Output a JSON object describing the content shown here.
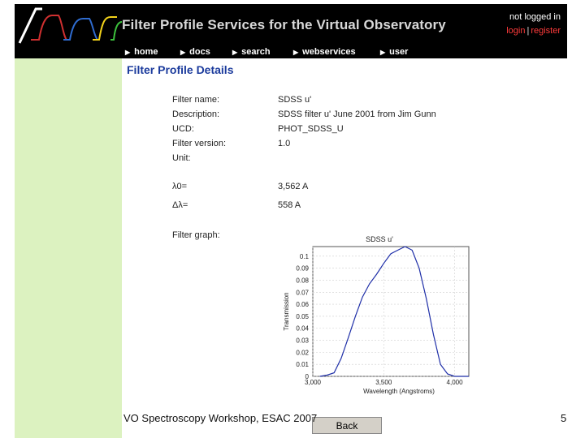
{
  "banner": {
    "title": "Filter Profile Services for the Virtual Observatory",
    "login_status": "not logged in",
    "login_link": "login",
    "separator": "|",
    "register_link": "register"
  },
  "nav": {
    "items": [
      {
        "label": "home"
      },
      {
        "label": "docs"
      },
      {
        "label": "search"
      },
      {
        "label": "webservices"
      },
      {
        "label": "user"
      }
    ]
  },
  "details": {
    "title": "Filter Profile Details",
    "rows": [
      {
        "label": "Filter name:",
        "value": "SDSS u'"
      },
      {
        "label": "Description:",
        "value": "SDSS filter u' June 2001 from Jim Gunn"
      },
      {
        "label": "UCD:",
        "value": "PHOT_SDSS_U"
      },
      {
        "label": "Filter version:",
        "value": "1.0"
      },
      {
        "label": "Unit:",
        "value": ""
      },
      {
        "label": "λ0=",
        "value": "3,562 A"
      },
      {
        "label": "Δλ=",
        "value": "558 A"
      },
      {
        "label": "Filter graph:",
        "value": ""
      }
    ]
  },
  "chart_data": {
    "type": "line",
    "title": "SDSS u'",
    "xlabel": "Wavelength (Angstroms)",
    "ylabel": "Transmission",
    "xlim": [
      3000,
      4100
    ],
    "ylim": [
      0,
      0.108
    ],
    "x_ticks": [
      "3,000",
      "3,500",
      "4,000"
    ],
    "y_ticks": [
      "0",
      "0.01",
      "0.02",
      "0.03",
      "0.04",
      "0.05",
      "0.06",
      "0.07",
      "0.08",
      "0.09",
      "0.1"
    ],
    "grid": true,
    "series": [
      {
        "color": "#1f2fa8",
        "x": [
          3050,
          3100,
          3150,
          3200,
          3250,
          3300,
          3350,
          3400,
          3450,
          3500,
          3550,
          3600,
          3650,
          3700,
          3750,
          3800,
          3850,
          3900,
          3950,
          4000,
          4050,
          4100
        ],
        "y": [
          0.0,
          0.001,
          0.003,
          0.015,
          0.032,
          0.05,
          0.066,
          0.077,
          0.085,
          0.094,
          0.102,
          0.105,
          0.108,
          0.105,
          0.09,
          0.065,
          0.035,
          0.01,
          0.002,
          0.0,
          0.0,
          0.0
        ]
      }
    ]
  },
  "back_button": {
    "label": "Back"
  },
  "footer": {
    "text": "VO Spectroscopy Workshop, ESAC 2007",
    "page_number": "5"
  },
  "colors": {
    "banner_bg": "#000000",
    "sidebar_bg": "#dcf2c0",
    "title_blue": "#1a3a9c",
    "login_red": "#ff3b3b",
    "curve_blue": "#1f2fa8"
  }
}
